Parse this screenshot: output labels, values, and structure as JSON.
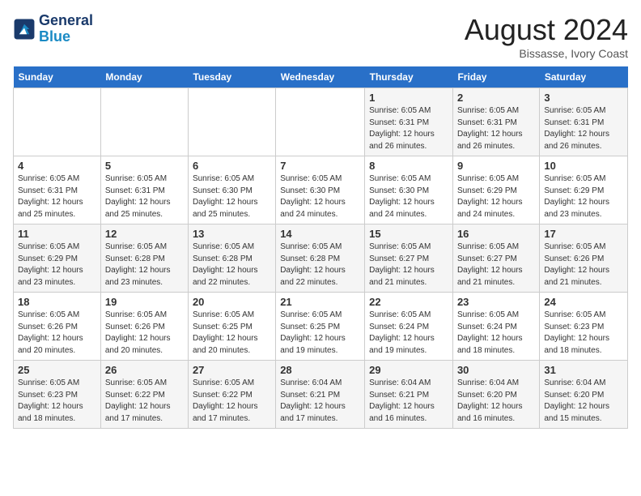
{
  "header": {
    "logo_line1": "General",
    "logo_line2": "Blue",
    "month_title": "August 2024",
    "location": "Bissasse, Ivory Coast"
  },
  "days_of_week": [
    "Sunday",
    "Monday",
    "Tuesday",
    "Wednesday",
    "Thursday",
    "Friday",
    "Saturday"
  ],
  "weeks": [
    [
      {
        "day": "",
        "detail": ""
      },
      {
        "day": "",
        "detail": ""
      },
      {
        "day": "",
        "detail": ""
      },
      {
        "day": "",
        "detail": ""
      },
      {
        "day": "1",
        "detail": "Sunrise: 6:05 AM\nSunset: 6:31 PM\nDaylight: 12 hours\nand 26 minutes."
      },
      {
        "day": "2",
        "detail": "Sunrise: 6:05 AM\nSunset: 6:31 PM\nDaylight: 12 hours\nand 26 minutes."
      },
      {
        "day": "3",
        "detail": "Sunrise: 6:05 AM\nSunset: 6:31 PM\nDaylight: 12 hours\nand 26 minutes."
      }
    ],
    [
      {
        "day": "4",
        "detail": "Sunrise: 6:05 AM\nSunset: 6:31 PM\nDaylight: 12 hours\nand 25 minutes."
      },
      {
        "day": "5",
        "detail": "Sunrise: 6:05 AM\nSunset: 6:31 PM\nDaylight: 12 hours\nand 25 minutes."
      },
      {
        "day": "6",
        "detail": "Sunrise: 6:05 AM\nSunset: 6:30 PM\nDaylight: 12 hours\nand 25 minutes."
      },
      {
        "day": "7",
        "detail": "Sunrise: 6:05 AM\nSunset: 6:30 PM\nDaylight: 12 hours\nand 24 minutes."
      },
      {
        "day": "8",
        "detail": "Sunrise: 6:05 AM\nSunset: 6:30 PM\nDaylight: 12 hours\nand 24 minutes."
      },
      {
        "day": "9",
        "detail": "Sunrise: 6:05 AM\nSunset: 6:29 PM\nDaylight: 12 hours\nand 24 minutes."
      },
      {
        "day": "10",
        "detail": "Sunrise: 6:05 AM\nSunset: 6:29 PM\nDaylight: 12 hours\nand 23 minutes."
      }
    ],
    [
      {
        "day": "11",
        "detail": "Sunrise: 6:05 AM\nSunset: 6:29 PM\nDaylight: 12 hours\nand 23 minutes."
      },
      {
        "day": "12",
        "detail": "Sunrise: 6:05 AM\nSunset: 6:28 PM\nDaylight: 12 hours\nand 23 minutes."
      },
      {
        "day": "13",
        "detail": "Sunrise: 6:05 AM\nSunset: 6:28 PM\nDaylight: 12 hours\nand 22 minutes."
      },
      {
        "day": "14",
        "detail": "Sunrise: 6:05 AM\nSunset: 6:28 PM\nDaylight: 12 hours\nand 22 minutes."
      },
      {
        "day": "15",
        "detail": "Sunrise: 6:05 AM\nSunset: 6:27 PM\nDaylight: 12 hours\nand 21 minutes."
      },
      {
        "day": "16",
        "detail": "Sunrise: 6:05 AM\nSunset: 6:27 PM\nDaylight: 12 hours\nand 21 minutes."
      },
      {
        "day": "17",
        "detail": "Sunrise: 6:05 AM\nSunset: 6:26 PM\nDaylight: 12 hours\nand 21 minutes."
      }
    ],
    [
      {
        "day": "18",
        "detail": "Sunrise: 6:05 AM\nSunset: 6:26 PM\nDaylight: 12 hours\nand 20 minutes."
      },
      {
        "day": "19",
        "detail": "Sunrise: 6:05 AM\nSunset: 6:26 PM\nDaylight: 12 hours\nand 20 minutes."
      },
      {
        "day": "20",
        "detail": "Sunrise: 6:05 AM\nSunset: 6:25 PM\nDaylight: 12 hours\nand 20 minutes."
      },
      {
        "day": "21",
        "detail": "Sunrise: 6:05 AM\nSunset: 6:25 PM\nDaylight: 12 hours\nand 19 minutes."
      },
      {
        "day": "22",
        "detail": "Sunrise: 6:05 AM\nSunset: 6:24 PM\nDaylight: 12 hours\nand 19 minutes."
      },
      {
        "day": "23",
        "detail": "Sunrise: 6:05 AM\nSunset: 6:24 PM\nDaylight: 12 hours\nand 18 minutes."
      },
      {
        "day": "24",
        "detail": "Sunrise: 6:05 AM\nSunset: 6:23 PM\nDaylight: 12 hours\nand 18 minutes."
      }
    ],
    [
      {
        "day": "25",
        "detail": "Sunrise: 6:05 AM\nSunset: 6:23 PM\nDaylight: 12 hours\nand 18 minutes."
      },
      {
        "day": "26",
        "detail": "Sunrise: 6:05 AM\nSunset: 6:22 PM\nDaylight: 12 hours\nand 17 minutes."
      },
      {
        "day": "27",
        "detail": "Sunrise: 6:05 AM\nSunset: 6:22 PM\nDaylight: 12 hours\nand 17 minutes."
      },
      {
        "day": "28",
        "detail": "Sunrise: 6:04 AM\nSunset: 6:21 PM\nDaylight: 12 hours\nand 17 minutes."
      },
      {
        "day": "29",
        "detail": "Sunrise: 6:04 AM\nSunset: 6:21 PM\nDaylight: 12 hours\nand 16 minutes."
      },
      {
        "day": "30",
        "detail": "Sunrise: 6:04 AM\nSunset: 6:20 PM\nDaylight: 12 hours\nand 16 minutes."
      },
      {
        "day": "31",
        "detail": "Sunrise: 6:04 AM\nSunset: 6:20 PM\nDaylight: 12 hours\nand 15 minutes."
      }
    ]
  ]
}
